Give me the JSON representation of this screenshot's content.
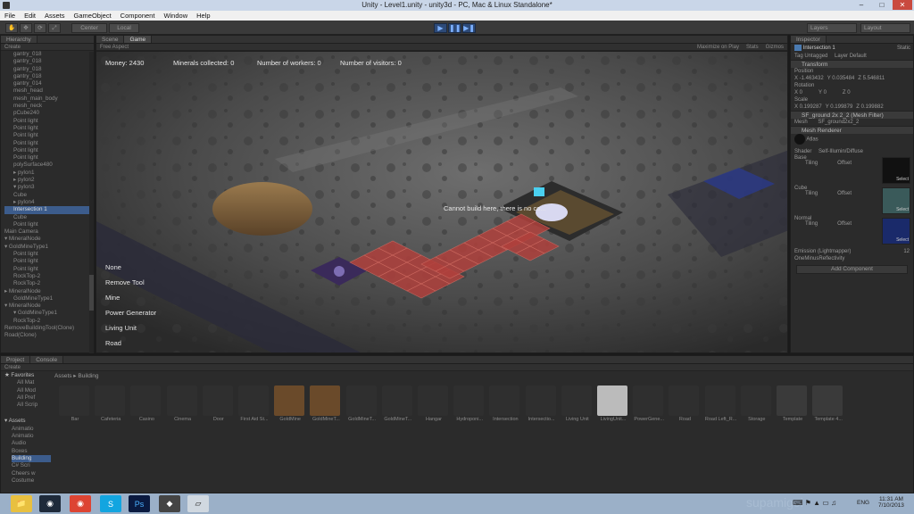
{
  "window": {
    "title": "Unity - Level1.unity - unity3d - PC, Mac & Linux Standalone*"
  },
  "menu": [
    "File",
    "Edit",
    "Assets",
    "GameObject",
    "Component",
    "Window",
    "Help"
  ],
  "toolbar": {
    "pivot": "Center",
    "local": "Local",
    "layers": "Layers",
    "layout": "Layout"
  },
  "hierarchy": {
    "tab": "Hierarchy",
    "create": "Create",
    "items": [
      "gantry_018",
      "gantry_018",
      "gantry_018",
      "gantry_018",
      "gantry_014",
      "mesh_head",
      "mesh_main_body",
      "mesh_neck",
      "pCube240",
      "Point light",
      "Point light",
      "Point light",
      "Point light",
      "Point light",
      "Point light",
      "polySurface480",
      "▸ pylon1",
      "▸ pylon2",
      "▾ pylon3",
      "Cube",
      "▸ pylon4",
      "Intersection 1",
      "Cube",
      "Point light",
      "Main Camera",
      "▾ MineralNode",
      "▾ GoldMineType1",
      "Point light",
      "Point light",
      "Point light",
      "RockTop-2",
      "RockTop-2",
      "▸ MineralNode",
      "GoldMineType1",
      "▾ MineralNode",
      "▾ GoldMineType1",
      "RockTop-2",
      "RemoveBuildingTool(Clone)",
      "Road(Clone)"
    ]
  },
  "scene": {
    "tabs": [
      "Scene",
      "Game"
    ],
    "aspect": "Free Aspect",
    "options": [
      "Maximize on Play",
      "Stats",
      "Gizmos"
    ],
    "hud": {
      "money": "Money: 2430",
      "minerals": "Minerals collected: 0",
      "workers": "Number of workers: 0",
      "visitors": "Number of visitors: 0"
    },
    "message": "Cannot build here, there is no co...",
    "tools": [
      "None",
      "Remove Tool",
      "Mine",
      "Power Generator",
      "Living Unit",
      "Road"
    ]
  },
  "inspector": {
    "tab": "Inspector",
    "object_name": "Intersection 1",
    "static": "Static",
    "tag": "Tag Untagged",
    "layer": "Layer Default",
    "transform": "Transform",
    "position": {
      "label": "Position",
      "x": "X -1.463432",
      "y": "Y 0.035484",
      "z": "Z 5.546811"
    },
    "rotation": {
      "label": "Rotation",
      "x": "X 0",
      "y": "Y 0",
      "z": "Z 0"
    },
    "scale": {
      "label": "Scale",
      "x": "X 0.199287",
      "y": "Y 0.199879",
      "z": "Z 0.199882"
    },
    "mesh_filter": "SF_ground 2x 2_2 (Mesh Filter)",
    "mesh": "Mesh",
    "mesh_value": "SF_ground2x2_2",
    "mesh_renderer": "Mesh Renderer",
    "material": "Atlas",
    "shader": "Shader",
    "shader_value": "Self-Illumin/Diffuse",
    "slots": [
      "Base",
      "Cube",
      "Normal"
    ],
    "tiling": "Tiling",
    "offset": "Offset",
    "select": "Select",
    "emission": "Emission (Lightmapper)",
    "emission_value": "12",
    "one_minus": "OneMinusReflectivity",
    "add_component": "Add Component"
  },
  "project": {
    "tabs": [
      "Project",
      "Console"
    ],
    "create": "Create",
    "breadcrumb": "Assets ▸ Building",
    "favorites": {
      "label": "Favorites",
      "items": [
        "All Mat",
        "All Mod",
        "All Pref",
        "All Scrip"
      ]
    },
    "assets": {
      "label": "Assets",
      "items": [
        "Animatio",
        "Animatio",
        "Audio",
        "Boxes",
        "Building",
        "C# Scri",
        "Cheers w",
        "Costume"
      ]
    },
    "files": [
      "Bar",
      "Cafeteria",
      "Casino",
      "Cinema",
      "Door",
      "First Aid St...",
      "GoldMine",
      "GoldMineT...",
      "GoldMineT...",
      "GoldMineT...",
      "Hangar",
      "Hydroponi...",
      "Intersection",
      "Intersectio...",
      "Living Unit",
      "LivingUnit...",
      "PowerGene...",
      "Road",
      "Road Left_R...",
      "Storage",
      "Template",
      "Template 4..."
    ]
  },
  "taskbar": {
    "time": "11:31 AM",
    "date": "7/10/2013",
    "lang": "ENG",
    "watermark": "supamigoi"
  }
}
